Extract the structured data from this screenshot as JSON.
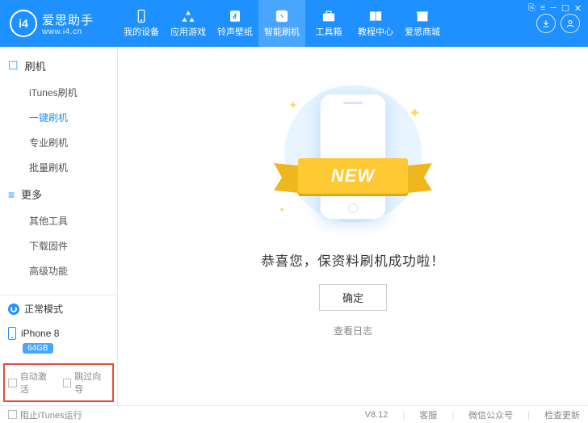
{
  "header": {
    "app_name": "爱思助手",
    "app_url": "www.i4.cn",
    "logo_text": "i4",
    "nav": [
      {
        "label": "我的设备",
        "icon": "phone"
      },
      {
        "label": "应用游戏",
        "icon": "apps"
      },
      {
        "label": "铃声壁纸",
        "icon": "music"
      },
      {
        "label": "智能刷机",
        "icon": "flash",
        "active": true
      },
      {
        "label": "工具箱",
        "icon": "toolbox"
      },
      {
        "label": "教程中心",
        "icon": "book"
      },
      {
        "label": "爱思商城",
        "icon": "store"
      }
    ],
    "win_controls": [
      "⎘",
      "≡",
      "─",
      "☐",
      "✕"
    ]
  },
  "sidebar": {
    "sections": [
      {
        "title": "刷机",
        "glyph": "☐",
        "items": [
          {
            "label": "iTunes刷机"
          },
          {
            "label": "一键刷机",
            "active": true
          },
          {
            "label": "专业刷机"
          },
          {
            "label": "批量刷机"
          }
        ]
      },
      {
        "title": "更多",
        "glyph": "≡",
        "items": [
          {
            "label": "其他工具"
          },
          {
            "label": "下载固件"
          },
          {
            "label": "高级功能"
          }
        ]
      }
    ],
    "mode_label": "正常模式",
    "device": {
      "name": "iPhone 8",
      "storage": "64GB"
    },
    "options": {
      "auto_activate": "自动激活",
      "skip_guide": "跳过向导"
    }
  },
  "content": {
    "ribbon_text": "NEW",
    "success_text": "恭喜您，保资料刷机成功啦！",
    "ok_button": "确定",
    "view_log": "查看日志"
  },
  "footer": {
    "block_itunes": "阻止iTunes运行",
    "version": "V8.12",
    "links": [
      "客服",
      "微信公众号",
      "检查更新"
    ]
  }
}
